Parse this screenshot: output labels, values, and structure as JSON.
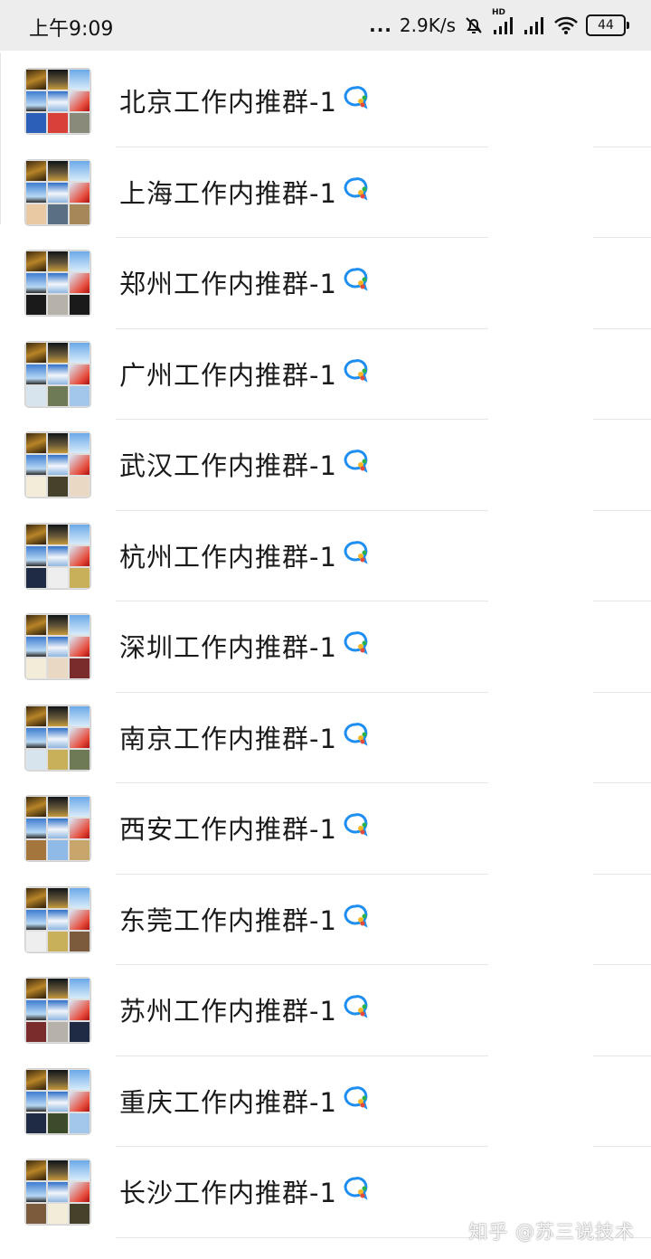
{
  "status_bar": {
    "time": "上午9:09",
    "dots": "...",
    "net_speed": "2.9K/s",
    "hd_label": "HD",
    "battery": "44"
  },
  "groups": [
    {
      "name": "北京工作内推群-1"
    },
    {
      "name": "上海工作内推群-1"
    },
    {
      "name": "郑州工作内推群-1"
    },
    {
      "name": "广州工作内推群-1"
    },
    {
      "name": "武汉工作内推群-1"
    },
    {
      "name": "杭州工作内推群-1"
    },
    {
      "name": "深圳工作内推群-1"
    },
    {
      "name": "南京工作内推群-1"
    },
    {
      "name": "西安工作内推群-1"
    },
    {
      "name": "东莞工作内推群-1"
    },
    {
      "name": "苏州工作内推群-1"
    },
    {
      "name": "重庆工作内推群-1"
    },
    {
      "name": "长沙工作内推群-1"
    }
  ],
  "watermark": "知乎 @苏三说技术"
}
